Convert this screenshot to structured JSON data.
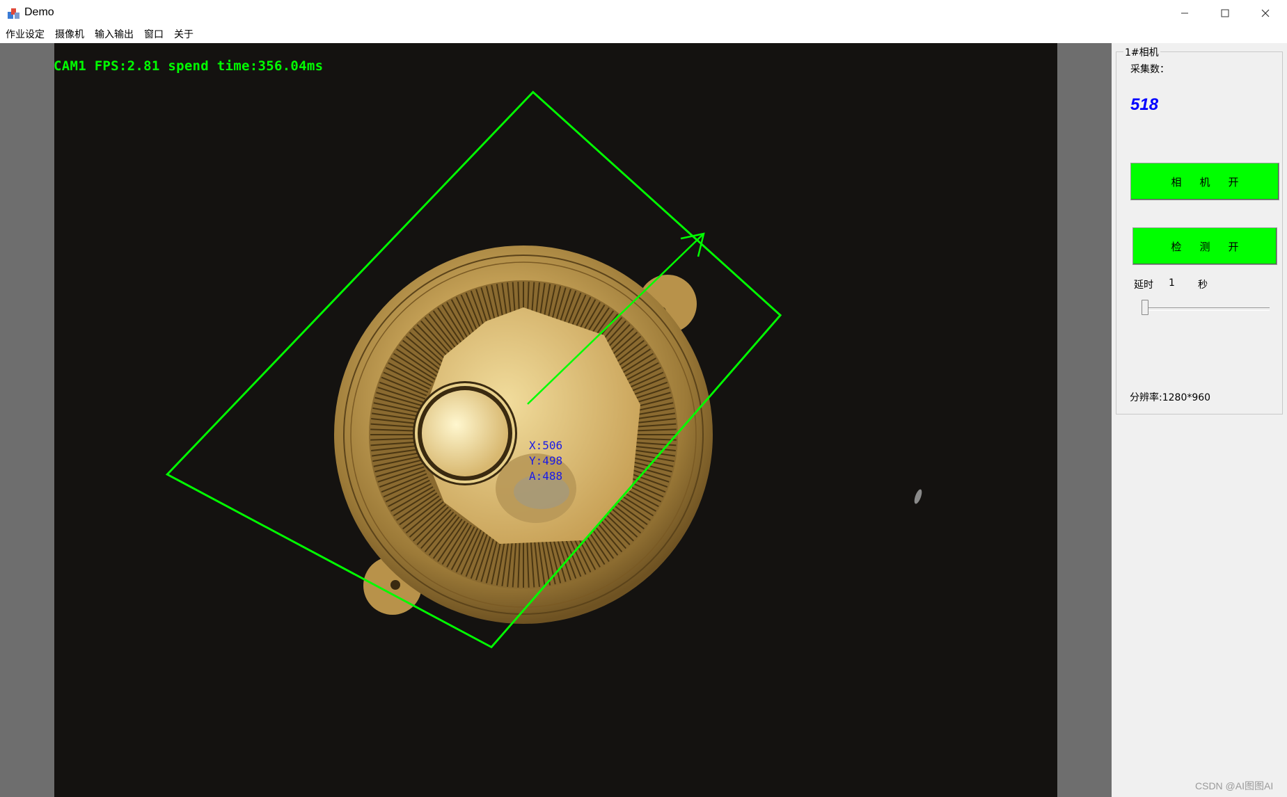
{
  "window": {
    "title": "Demo",
    "minimize_icon": "minimize-icon",
    "maximize_icon": "maximize-icon",
    "close_icon": "close-icon"
  },
  "menu": {
    "items": [
      "作业设定",
      "摄像机",
      "输入输出",
      "窗口",
      "关于"
    ]
  },
  "camera_view": {
    "overlay_status": "CAM1  FPS:2.81  spend time:356.04ms",
    "coord_x": "X:506",
    "coord_y": "Y:498",
    "coord_a": "A:488",
    "overlay_color": "#00ff00",
    "coord_color": "#1a1ae6"
  },
  "panel": {
    "group_title": "1#相机",
    "count_label": "采集数：",
    "count_value": "518",
    "camera_button": "相机开",
    "detect_button": "检测开",
    "delay_label": "延时",
    "delay_value": "1",
    "delay_unit": "秒",
    "resolution": "分辨率:1280*960",
    "button_color": "#00ff00",
    "count_color": "#0000ff"
  },
  "watermark": "CSDN @AI图图AI"
}
